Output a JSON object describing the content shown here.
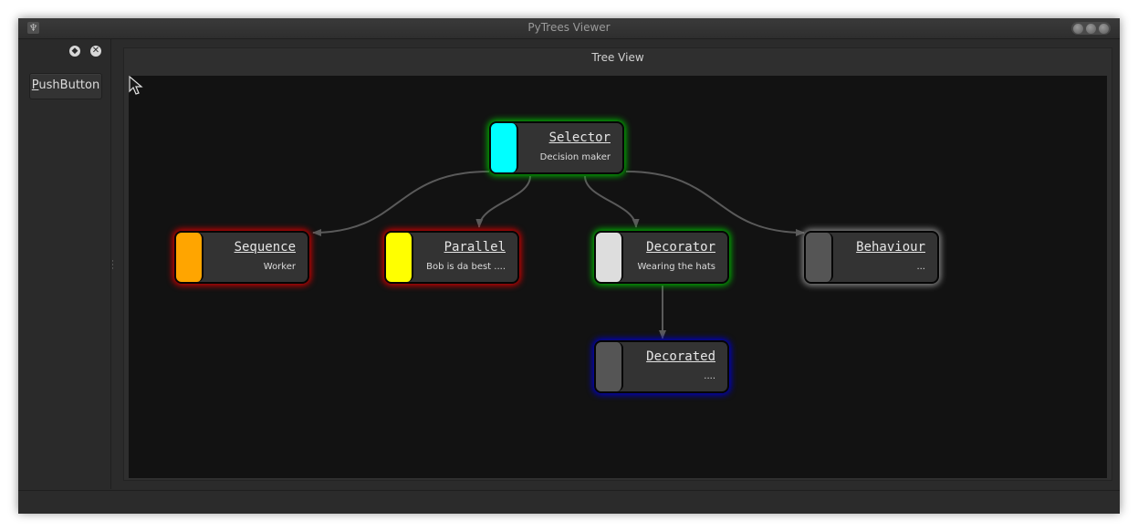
{
  "window": {
    "title": "PyTrees Viewer",
    "icon": "app-icon"
  },
  "dock": {
    "push_button_label": "PushButton",
    "float_icon": "float-icon",
    "close_icon": "close-icon"
  },
  "tree_view": {
    "title": "Tree View",
    "nodes": [
      {
        "name": "Selector",
        "description": "Decision maker",
        "color": "#00ffff",
        "glow": "#00b000"
      },
      {
        "name": "Sequence",
        "description": "Worker",
        "color": "#ffa500",
        "glow": "#d00000"
      },
      {
        "name": "Parallel",
        "description": "Bob is da best ....",
        "color": "#ffff00",
        "glow": "#d00000"
      },
      {
        "name": "Decorator",
        "description": "Wearing the hats",
        "color": "#dddddd",
        "glow": "#00b000"
      },
      {
        "name": "Behaviour",
        "description": "...",
        "color": "#555555",
        "glow": "#8a8a8a"
      },
      {
        "name": "Decorated",
        "description": "....",
        "color": "#555555",
        "glow": "#0000c8"
      }
    ]
  },
  "colors": {
    "canvas_background": "#121212",
    "edge": "#5a5a5a"
  }
}
